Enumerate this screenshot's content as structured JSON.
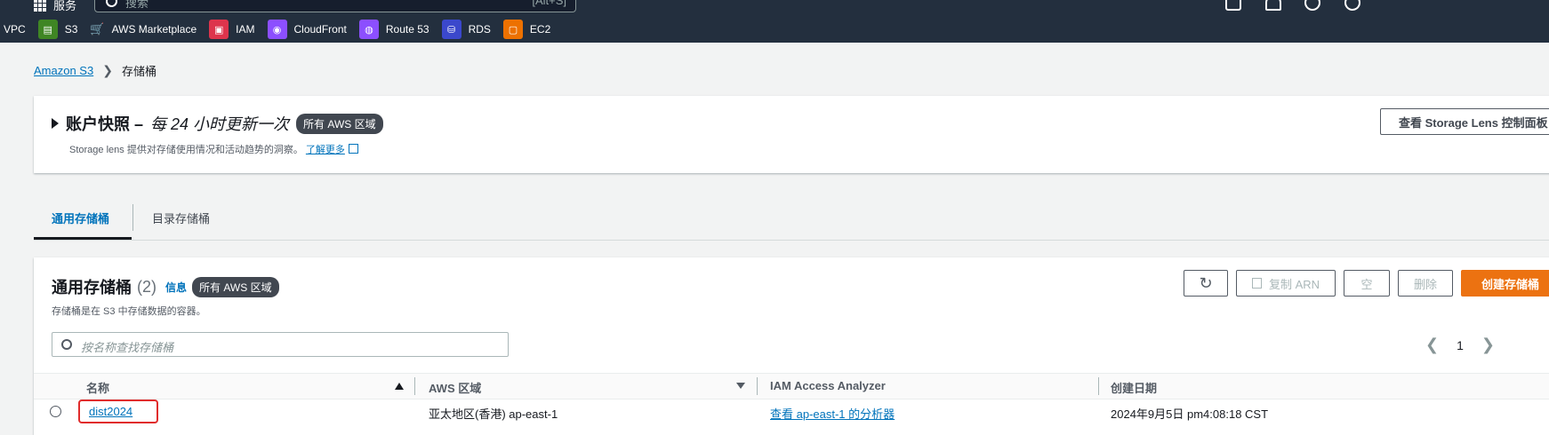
{
  "topnav": {
    "services_label": "服务",
    "search_placeholder": "搜索",
    "search_shortcut": "[Alt+S]",
    "favorites": [
      {
        "label": "VPC",
        "icon": "vpc-icon",
        "color": ""
      },
      {
        "label": "S3",
        "icon": "s3-icon",
        "color": "#3f8624"
      },
      {
        "label": "AWS Marketplace",
        "icon": "cart-icon",
        "color": ""
      },
      {
        "label": "IAM",
        "icon": "iam-icon",
        "color": "#dd344c"
      },
      {
        "label": "CloudFront",
        "icon": "cloudfront-icon",
        "color": "#8c4fff"
      },
      {
        "label": "Route 53",
        "icon": "route53-icon",
        "color": "#8c4fff"
      },
      {
        "label": "RDS",
        "icon": "rds-icon",
        "color": "#3b48cc"
      },
      {
        "label": "EC2",
        "icon": "ec2-icon",
        "color": "#ed7100"
      }
    ]
  },
  "breadcrumb": {
    "root": "Amazon S3",
    "current": "存储桶"
  },
  "snapshot": {
    "title": "账户快照 –",
    "subtitle": "每 24 小时更新一次",
    "badge": "所有 AWS 区域",
    "desc": "Storage lens 提供对存储使用情况和活动趋势的洞察。",
    "learn_more": "了解更多",
    "lens_button": "查看 Storage Lens 控制面板"
  },
  "tabs": [
    {
      "label": "通用存储桶"
    },
    {
      "label": "目录存储桶"
    }
  ],
  "buckets": {
    "title": "通用存储桶",
    "count": "(2)",
    "info": "信息",
    "badge": "所有 AWS 区域",
    "desc": "存储桶是在 S3 中存储数据的容器。",
    "search_placeholder": "按名称查找存储桶",
    "actions": {
      "copy_arn": "复制 ARN",
      "empty": "空",
      "delete": "删除",
      "create": "创建存储桶"
    },
    "page": "1",
    "columns": [
      "名称",
      "AWS 区域",
      "IAM Access Analyzer",
      "创建日期"
    ],
    "rows": [
      {
        "name": "dist2024",
        "region": "亚太地区(香港) ap-east-1",
        "analyzer": "查看 ap-east-1 的分析器",
        "created": "2024年9月5日 pm4:08:18 CST"
      }
    ]
  },
  "colors": {
    "accent": "#0073bb",
    "nav_bg": "#232f3e",
    "primary_button": "#ec7211",
    "highlight": "#e02c2c"
  }
}
